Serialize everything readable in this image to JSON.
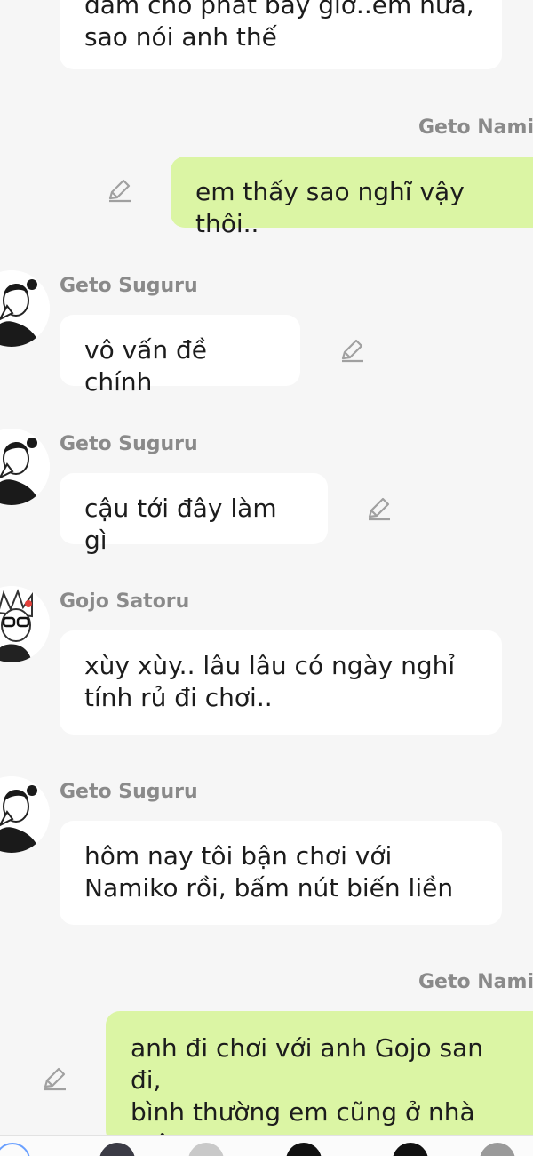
{
  "messages": [
    {
      "text": "đám cho phát bây giờ..em nữa,\nsao nói anh thế"
    },
    {
      "sender": "Geto Namik",
      "text": "em thấy sao nghĩ vậy thôi..",
      "edit_icon": "pencil-icon"
    },
    {
      "sender": "Geto Suguru",
      "text": "vô vấn đề chính",
      "edit_icon": "pencil-icon",
      "avatar": "avatar-geto-suguru"
    },
    {
      "sender": "Geto Suguru",
      "text": "cậu tới đây làm gì",
      "edit_icon": "pencil-icon",
      "avatar": "avatar-geto-suguru"
    },
    {
      "sender": "Gojo Satoru",
      "text": "xùy xùy.. lâu lâu có ngày nghỉ\ntính rủ đi chơi..",
      "avatar": "avatar-gojo-satoru"
    },
    {
      "sender": "Geto Suguru",
      "text": "hôm nay tôi bận chơi với\nNamiko rồi, bấm nút biến liền",
      "avatar": "avatar-geto-suguru"
    },
    {
      "sender": "Geto Namik",
      "text": "anh đi chơi với anh Gojo san đi,\nbình thường em cũng ở nhà một\nmình cũng quen rồi",
      "edit_icon": "pencil-icon"
    }
  ],
  "colors": {
    "background": "#f6f6f6",
    "incoming_bubble": "#ffffff",
    "outgoing_bubble": "#dbf5a4",
    "sender_name": "#8a8a8a",
    "icon": "#a0a0a0"
  }
}
